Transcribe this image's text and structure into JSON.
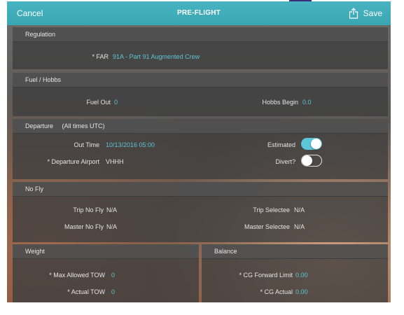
{
  "header": {
    "cancel": "Cancel",
    "title": "PRE-FLIGHT",
    "save": "Save"
  },
  "regulation": {
    "heading": "Regulation",
    "far_label": "* FAR",
    "far_value": "91A - Part 91 Augmented Crew"
  },
  "fuel_hobbs": {
    "heading": "Fuel / Hobbs",
    "fuel_out_label": "Fuel Out",
    "fuel_out_value": "0",
    "hobbs_begin_label": "Hobbs Begin",
    "hobbs_begin_value": "0.0"
  },
  "departure": {
    "heading": "Departure",
    "heading_note": "(All times UTC)",
    "out_time_label": "Out Time",
    "out_time_value": "10/13/2016 05:00",
    "airport_label": "* Departure Airport",
    "airport_value": "VHHH",
    "estimated_label": "Estimated",
    "estimated_on": true,
    "divert_label": "Divert?",
    "divert_on": false
  },
  "no_fly": {
    "heading": "No Fly",
    "trip_no_fly_label": "Trip No Fly",
    "trip_no_fly_value": "N/A",
    "master_no_fly_label": "Master No Fly",
    "master_no_fly_value": "N/A",
    "trip_selectee_label": "Trip Selectee",
    "trip_selectee_value": "N/A",
    "master_selectee_label": "Master Selectee",
    "master_selectee_value": "N/A"
  },
  "weight": {
    "heading": "Weight",
    "max_tow_label": "* Max Allowed TOW",
    "max_tow_value": "0",
    "actual_tow_label": "* Actual TOW",
    "actual_tow_value": "0"
  },
  "balance": {
    "heading": "Balance",
    "cg_fwd_label": "* CG Forward Limit",
    "cg_fwd_value": "0.00",
    "cg_actual_label": "* CG Actual",
    "cg_actual_value": "0.00"
  },
  "colors": {
    "accent": "#49b4c1",
    "value_blue": "#5ec3d6"
  }
}
